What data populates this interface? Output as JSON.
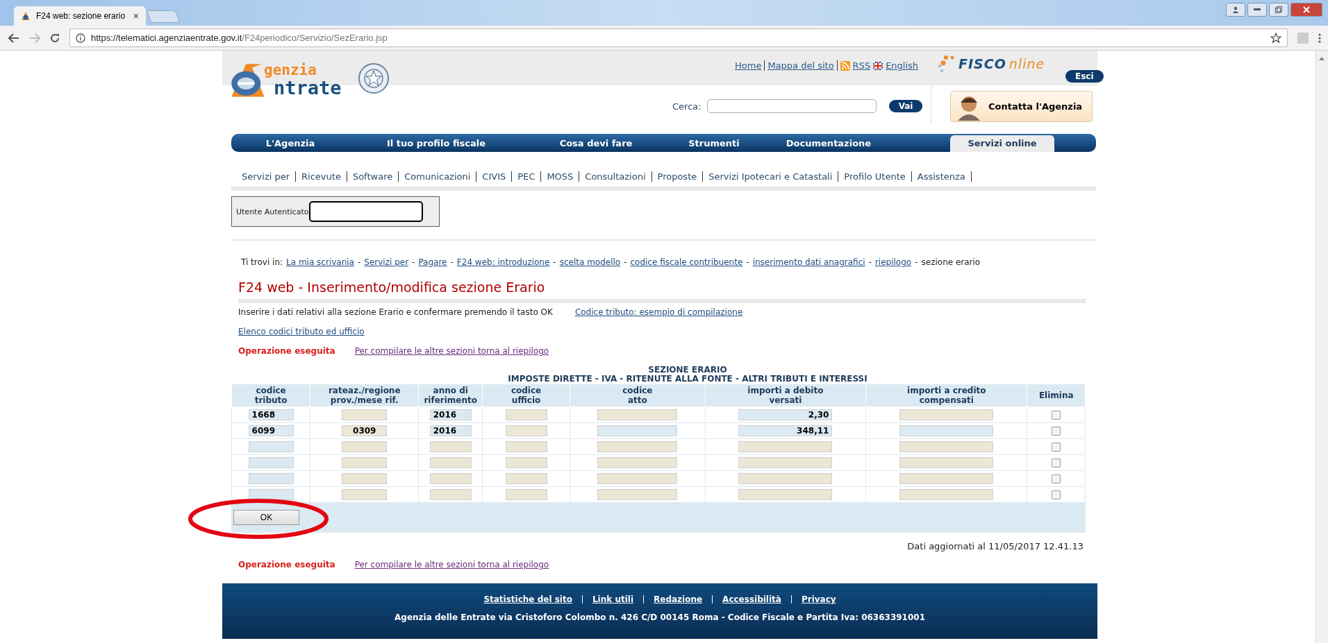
{
  "browser": {
    "tab_title": "F24 web: sezione erario",
    "tab_close": "×",
    "url_host": "https://telematici.agenziaentrate.gov.it",
    "url_path": "/F24periodico/Servizio/SezErario.jsp"
  },
  "header": {
    "logo_top": "genzia",
    "logo_bottom": "ntrate",
    "top_links": [
      "Home",
      "Mappa del sito",
      "RSS",
      "English"
    ],
    "fisconline_a": "FISCO",
    "fisconline_b": "nline",
    "exit_button": "Esci",
    "search_label": "Cerca:",
    "search_button": "Vai",
    "contact_button": "Contatta l'Agenzia"
  },
  "nav": [
    {
      "label": "L'Agenzia",
      "selected": false
    },
    {
      "label": "Il tuo profilo fiscale",
      "selected": false
    },
    {
      "label": "Cosa devi fare",
      "selected": false
    },
    {
      "label": "Strumenti",
      "selected": false
    },
    {
      "label": "Documentazione",
      "selected": false
    },
    {
      "label": "Servizi online",
      "selected": true
    }
  ],
  "subnav": [
    "Servizi per",
    "Ricevute",
    "Software",
    "Comunicazioni",
    "CIVIS",
    "PEC",
    "MOSS",
    "Consultazioni",
    "Proposte",
    "Servizi Ipotecari e Catastali",
    "Profilo Utente",
    "Assistenza"
  ],
  "user_label": "Utente Autenticato",
  "breadcrumb": {
    "prefix": "Ti trovi in:",
    "separator": "-",
    "links": [
      "La mia scrivania",
      "Servizi per",
      "Pagare",
      "F24 web: introduzione",
      "scelta modello",
      "codice fiscale contribuente",
      "inserimento dati anagrafici",
      "riepilogo"
    ],
    "current": "sezione erario"
  },
  "page_title": "F24 web - Inserimento/modifica sezione Erario",
  "intro": "Inserire i dati relativi alla sezione Erario e confermare premendo il tasto OK",
  "example_link": "Codice tributo: esempio di compilazione",
  "codes_link": "Elenco codici tributo ed ufficio",
  "status_top": {
    "message": "Operazione eseguita",
    "link": "Per compilare le altre sezioni torna al riepilogo"
  },
  "table": {
    "title": "SEZIONE ERARIO",
    "subtitle": "IMPOSTE DIRETTE - IVA - RITENUTE ALLA FONTE - ALTRI TRIBUTI E INTERESSI",
    "columns": [
      "codice tributo",
      "rateaz./regione prov./mese rif.",
      "anno di riferimento",
      "codice ufficio",
      "codice atto",
      "importi a debito versati",
      "importi a credito compensati",
      "Elimina"
    ],
    "rows": [
      {
        "cells": [
          {
            "value": "1668",
            "enabled": true
          },
          {
            "enabled": false
          },
          {
            "value": "2016",
            "enabled": true
          },
          {
            "enabled": false
          },
          {
            "enabled": false
          },
          {
            "value": "2,30",
            "enabled": true
          },
          {
            "enabled": false
          }
        ],
        "checked": false
      },
      {
        "cells": [
          {
            "value": "6099",
            "enabled": true
          },
          {
            "value": "0309",
            "enabled": false
          },
          {
            "value": "2016",
            "enabled": true
          },
          {
            "enabled": false
          },
          {
            "enabled": true
          },
          {
            "value": "348,11",
            "enabled": true
          },
          {
            "enabled": true
          }
        ],
        "checked": false
      },
      {
        "cells": [
          {
            "enabled": true
          },
          {
            "enabled": false
          },
          {
            "enabled": false
          },
          {
            "enabled": false
          },
          {
            "enabled": false
          },
          {
            "enabled": false
          },
          {
            "enabled": false
          }
        ],
        "checked": false
      },
      {
        "cells": [
          {
            "enabled": true
          },
          {
            "enabled": false
          },
          {
            "enabled": false
          },
          {
            "enabled": false
          },
          {
            "enabled": false
          },
          {
            "enabled": false
          },
          {
            "enabled": false
          }
        ],
        "checked": false
      },
      {
        "cells": [
          {
            "enabled": true
          },
          {
            "enabled": false
          },
          {
            "enabled": false
          },
          {
            "enabled": false
          },
          {
            "enabled": false
          },
          {
            "enabled": false
          },
          {
            "enabled": false
          }
        ],
        "checked": false
      },
      {
        "cells": [
          {
            "enabled": true
          },
          {
            "enabled": false
          },
          {
            "enabled": false
          },
          {
            "enabled": false
          },
          {
            "enabled": false
          },
          {
            "enabled": false
          },
          {
            "enabled": false
          }
        ],
        "checked": false
      }
    ],
    "ok_button": "OK"
  },
  "updated": "Dati aggiornati al 11/05/2017 12.41.13",
  "status_bottom": {
    "message": "Operazione eseguita",
    "link": "Per compilare le altre sezioni torna al riepilogo"
  },
  "footer": {
    "links": [
      "Statistiche del sito",
      "Link utili",
      "Redazione",
      "Accessibilità",
      "Privacy"
    ],
    "address": "Agenzia delle Entrate via Cristoforo Colombo n. 426 C/D 00145 Roma - Codice Fiscale e Partita Iva: 06363391001"
  }
}
